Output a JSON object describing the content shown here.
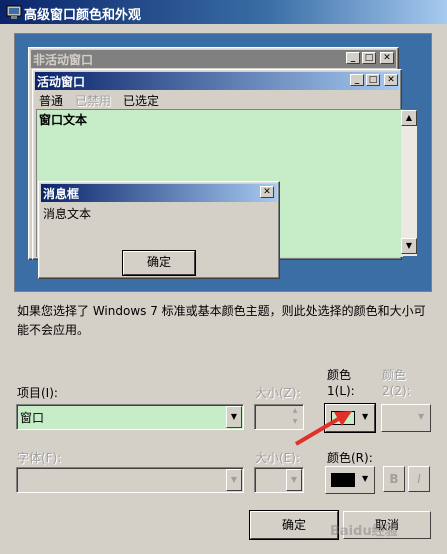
{
  "window": {
    "title": "高级窗口颜色和外观",
    "icon": "display-properties-icon"
  },
  "preview": {
    "inactive_title": "非活动窗口",
    "active_title": "活动窗口",
    "menu": [
      "普通",
      "已禁用",
      "已选定"
    ],
    "window_text": "窗口文本",
    "message_box": {
      "title": "消息框",
      "text": "消息文本",
      "ok": "确定"
    },
    "caption_buttons": [
      "_",
      "□",
      "✕"
    ]
  },
  "info_text": "如果您选择了 Windows 7 标准或基本颜色主题，则此处选择的颜色和大小可能不会应用。",
  "item": {
    "label": "项目(I):",
    "value": "窗口"
  },
  "size1": {
    "label": "大小(Z):"
  },
  "color1": {
    "label_line1": "颜色",
    "label_line2": "1(L):",
    "value": "#c6ecc8"
  },
  "color2": {
    "label_line1": "颜色",
    "label_line2": "2(2):"
  },
  "font": {
    "label": "字体(F):"
  },
  "size2": {
    "label": "大小(E):"
  },
  "font_color": {
    "label": "颜色(R):",
    "value": "#000000"
  },
  "bold_label": "B",
  "italic_label": "I",
  "buttons": {
    "ok": "确定",
    "cancel": "取消"
  },
  "watermark": "Baidu经验",
  "colors": {
    "active_title": "#0a246a",
    "desktop": "#3a6ea5",
    "window_bg": "#c6ecc8",
    "arrow": "#e0302a"
  }
}
